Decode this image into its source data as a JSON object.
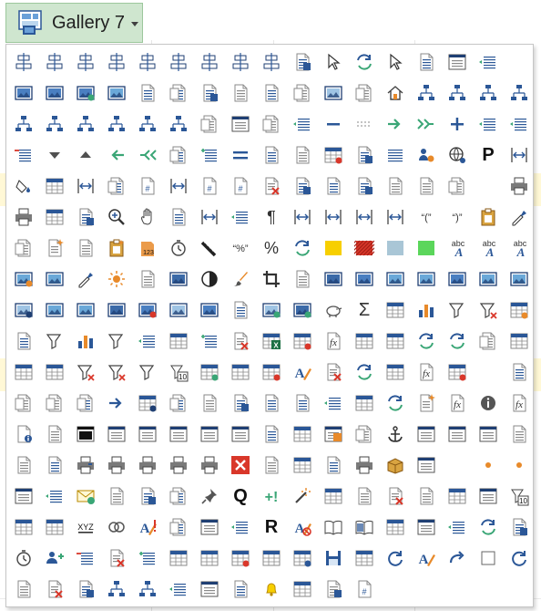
{
  "gallery": {
    "button_label": "Gallery 7",
    "button_icon": "gallery-icon"
  },
  "colors": {
    "blue": "#2b5797",
    "navy": "#1f3f73",
    "gray": "#8a8a8a",
    "green": "#3aa676",
    "orange": "#e88a2a",
    "red": "#d9372a",
    "yellow": "#f7cf00",
    "swatch_light_blue": "#a9c6d6",
    "swatch_green": "#5bd65b",
    "panel_bg": "#ffffff",
    "hover_bg": "#e5f1e5"
  },
  "icons": [
    "distribute-columns-icon",
    "align-center-horizontal-icon",
    "align-middle-icon",
    "align-left-objects-icon",
    "align-center-objects-icon",
    "align-right-objects-icon",
    "align-top-objects-icon",
    "resize-to-smallest-icon",
    "resize-to-largest-icon",
    "select-object-icon",
    "select-objects-pointer-icon",
    "rotate-object-icon",
    "pointer-arrow-icon",
    "bounding-box-icon",
    "restore-window-icon",
    "document-list-icon",
    "blank-cell-icon",
    "picture-frame-icon",
    "picture-settings-icon",
    "picture-delete-icon",
    "picture-stack-icon",
    "page-send-back-icon",
    "page-bring-forward-icon",
    "page-send-backward-icon",
    "page-center-icon",
    "page-layers-icon",
    "page-duplicate-icon",
    "picture-sparkle-icon",
    "onenote-edit-icon",
    "home-icon",
    "org-chart-icon",
    "hierarchy-icon",
    "tree-diagram-icon",
    "flowchart-icon",
    "flow-steps-icon",
    "process-chart-icon",
    "org-chart-collapse-icon",
    "org-chart-expand-icon",
    "hierarchy-add-icon",
    "org-chart-team-icon",
    "connector-elbow-icon",
    "page-frame-icon",
    "page-insert-icon",
    "indent-arrow-icon",
    "minus-icon",
    "dashed-line-icon",
    "arrow-right-icon",
    "double-arrow-right-icon",
    "plus-icon",
    "indent-lines-icon",
    "outline-icon",
    "decrease-list-icon",
    "dropdown-down-icon",
    "dropdown-up-icon",
    "arrow-left-icon",
    "double-arrow-left-icon",
    "insert-row-icon",
    "increase-list-icon",
    "equals-lines-icon",
    "zoom-minus-icon",
    "font-size-icon",
    "table-properties-icon",
    "compare-documents-icon",
    "align-justify-icon",
    "users-settings-icon",
    "globe-settings-icon",
    "letter-p-icon",
    "column-width-icon",
    "bucket-fill-icon",
    "move-sheet-icon",
    "page-margins-icon",
    "folder-settings-icon",
    "page-number-icon",
    "page-break-icon",
    "header-footer-icon",
    "document-header-icon",
    "delete-page-icon",
    "copy-pages-icon",
    "page-blank-icon",
    "page-lined-icon",
    "page-copy-icon",
    "page-upload-icon",
    "shape-nodes-icon",
    "blank-cell-icon",
    "print-preview-icon",
    "printer-page-icon",
    "page-grid-icon",
    "page-curl-icon",
    "zoom-in-icon",
    "hand-pan-icon",
    "paragraph-page-icon",
    "spread-horizontal-icon",
    "align-indent-left-icon",
    "paragraph-mark-icon",
    "line-break-icon",
    "column-break-icon",
    "expand-vertical-icon",
    "collapse-vertical-icon",
    "quote-open-icon",
    "quote-close-icon",
    "clipboard-paste-icon",
    "eyedropper-icon",
    "page-globe-icon",
    "page-sparkle-icon",
    "percent-page-icon",
    "clipboard-sparkle-icon",
    "clipboard-number-icon",
    "timer-icon",
    "ruler-diagonal-icon",
    "percent-quote-icon",
    "percent-sign-icon",
    "mail-remove-icon",
    "yellow-swatch-icon",
    "red-pattern-swatch-icon",
    "light-blue-swatch-icon",
    "green-swatch-icon",
    "spelling-abc-icon",
    "text-abc-icon",
    "spell-check-icon",
    "picture-edit-icon",
    "picture-compress-icon",
    "eyedropper-pen-icon",
    "brightness-icon",
    "color-adjust-icon",
    "picture-reset-icon",
    "contrast-icon",
    "brush-paint-icon",
    "crop-icon",
    "shapes-colors-icon",
    "picture-landscape-icon",
    "picture-wide-icon",
    "picture-blue-icon",
    "picture-strip-icon",
    "picture-page-icon",
    "picture-panel-icon",
    "picture-black-border-icon",
    "picture-blue-fill-icon",
    "picture-faded-icon",
    "picture-pale-icon",
    "picture-stack-layered-icon",
    "picture-rotate-icon",
    "picture-crop-icon",
    "picture-framed-icon",
    "artistic-effects-icon",
    "picture-cutout-icon",
    "picture-shrink-icon",
    "piggy-bank-icon",
    "sum-icon",
    "filter-table-icon",
    "pivot-chart-icon",
    "sort-filter-icon",
    "clear-filter-icon",
    "columns-chart-icon",
    "fit-arrows-icon",
    "sort-az-icon",
    "bar-chart-icon",
    "sort-za-pen-icon",
    "list-lines-icon",
    "table-header-icon",
    "list-add-icon",
    "delete-row-icon",
    "excel-table-icon",
    "table-columns-icon",
    "function-fx-icon",
    "table-formula-icon",
    "table-refresh-icon",
    "undo-arrow-icon",
    "redo-arrow-icon",
    "insert-cells-icon",
    "table-cut-icon",
    "table-remove-icon",
    "table-data-icon",
    "sum-delete-icon",
    "percent-delete-icon",
    "filter-top10-icon",
    "top10-icon",
    "table-add-icon",
    "table-scroll-icon",
    "table-gridlines-icon",
    "page-open-icon",
    "eraser-page-icon",
    "page-move-icon",
    "info-table-icon",
    "fx-page-icon",
    "table-swap-icon",
    "blank-cell-icon",
    "page-single-icon",
    "page-double-icon",
    "page-text-icon",
    "page-plain-icon",
    "arrow-right-blue-icon",
    "page-grid-small-icon",
    "page-ruled-icon",
    "page-columns-icon",
    "page-summary-icon",
    "page-report-icon",
    "page-layout-icon",
    "page-list-icon",
    "fx-sheet-icon",
    "arrow-swap-icon",
    "sparkle-page-icon",
    "page-fx-icon",
    "info-circle-icon",
    "function-italic-icon",
    "page-info-icon",
    "page-view-icon",
    "black-window-icon",
    "window-arrow-icon",
    "page-window-icon",
    "page-window-alt-icon",
    "page-form-icon",
    "page-form-alt-icon",
    "page-stack-icon",
    "form-grid-icon",
    "orange-frame-icon",
    "quote-marks-icon",
    "anchor-icon",
    "window-preview-icon",
    "address-card-icon",
    "move-card-icon",
    "page-pointer-icon",
    "page-square-icon",
    "page-paragraph-icon",
    "printer-blue-icon",
    "printer-frame-icon",
    "printer-alt-icon",
    "printer-gray-icon",
    "printer-sheet-icon",
    "close-x-red-icon",
    "page-refresh-icon",
    "sheet-duplicate-icon",
    "page-overlay-icon",
    "print-table-icon",
    "open-box-icon",
    "form-layout-icon",
    "blank-cell-icon",
    "orange-dot-icon",
    "orange-bullet-icon",
    "card-header-icon",
    "list-card-icon",
    "mail-checkmark-icon",
    "lock-page-icon",
    "page-button-icon",
    "page-highlight-icon",
    "pushpin-icon",
    "letter-q-icon",
    "plus-exclamation-icon",
    "wand-icon",
    "table-outline-icon",
    "ruler-check-icon",
    "exclamation-delete-icon",
    "upload-arrow-icon",
    "sparkle-table-icon",
    "help-window-icon",
    "filter-number-icon",
    "table-blue-icon",
    "table-header-alt-icon",
    "text-xyz-icon",
    "circles-icon",
    "pen-exclamation-icon",
    "report-page-icon",
    "text-a-format-icon",
    "text-a-outline-icon",
    "letter-r-icon",
    "pencil-forbidden-icon",
    "book-open-icon",
    "book-blue-icon",
    "table-select-icon",
    "frame-selection-icon",
    "page-lines-icon",
    "pages-swap-icon",
    "fill-cell-icon",
    "timer-sparkle-icon",
    "add-user-icon",
    "decrease-indent-icon",
    "delete-item-icon",
    "increase-indent-icon",
    "grid-table-icon",
    "grid-select-icon",
    "grid-alt-icon",
    "user-table-icon",
    "save-table-icon",
    "save-blue-icon",
    "page-form-grid-icon",
    "refresh-icon",
    "page-pen-icon",
    "redo-curve-icon",
    "blank-square-icon",
    "page-sync-icon",
    "page-refresh-alt-icon",
    "page-delete-icon",
    "page-stack-alt-icon",
    "hierarchy-table-icon",
    "hierarchy-branch-icon",
    "blank-list-icon",
    "form-entry-icon",
    "page-bars-icon",
    "bell-icon",
    "delete-sheet-icon",
    "bar-boxes-icon",
    "hash-page-icon",
    "blank-cell-icon",
    "blank-cell-icon",
    "blank-cell-icon",
    "blank-cell-icon"
  ],
  "icon_labels": {
    "yellow-swatch-icon": "",
    "letter-p-icon": "P",
    "letter-q-icon": "Q",
    "letter-r-icon": "R",
    "percent-sign-icon": "%",
    "sum-icon": "Σ",
    "paragraph-mark-icon": "¶",
    "quote-open-icon": "“(”",
    "quote-close-icon": "“)”",
    "text-abc-icon": "abc",
    "spelling-abc-icon": "abc",
    "spell-check-icon": "abc",
    "percent-quote-icon": "“%”",
    "text-xyz-icon": "XYZ",
    "top10-icon": "10",
    "filter-number-icon": "10",
    "clipboard-number-icon": "123"
  }
}
